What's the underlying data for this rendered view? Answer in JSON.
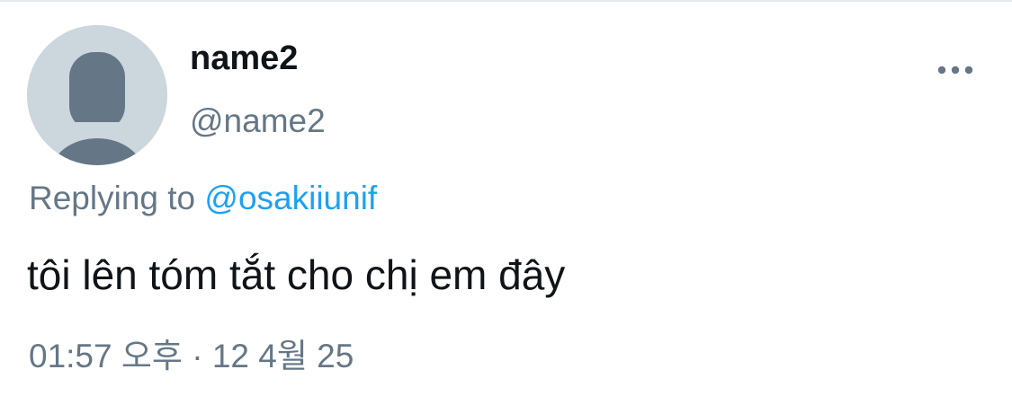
{
  "tweet": {
    "display_name": "name2",
    "handle": "@name2",
    "avatar_icon": "default-avatar-icon",
    "more_icon": "more-dots-icon",
    "reply_prefix": "Replying to ",
    "reply_mention": "@osakiiunif",
    "text": "tôi lên tóm tắt cho chị em đây",
    "timestamp": "01:57 오후 · 12 4월 25"
  },
  "colors": {
    "text_primary": "#0f1419",
    "text_secondary": "#657786",
    "link": "#1da1f2",
    "avatar_bg": "#ccd6dd",
    "avatar_fg": "#657786"
  }
}
